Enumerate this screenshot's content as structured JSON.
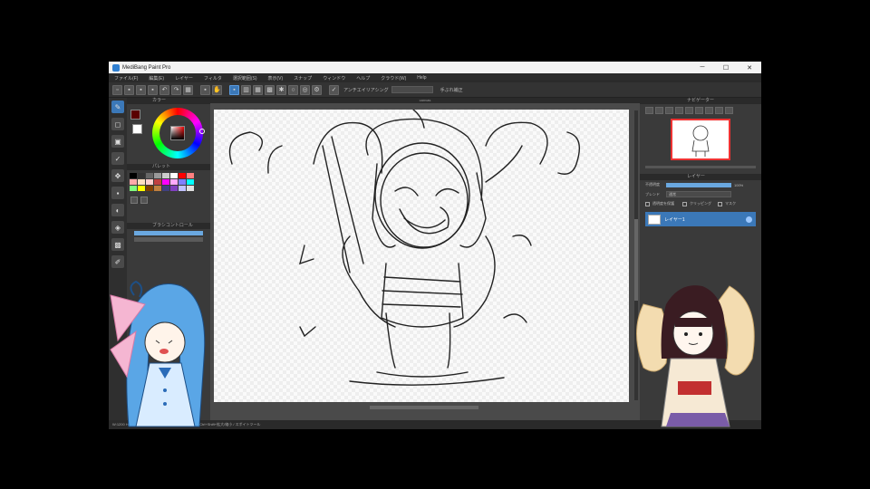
{
  "window": {
    "title": "MediBang Paint Pro",
    "minimize": "─",
    "maximize": "☐",
    "close": "✕"
  },
  "colors": {
    "accent": "#3b78b8",
    "panel": "#3a3a3a",
    "opacity_bar": "#6aa8e0",
    "navigator_border": "#ee3333"
  },
  "menu": {
    "items": [
      "ファイル(F)",
      "編集(E)",
      "レイヤー",
      "フィルタ",
      "選択範囲(S)",
      "表示(V)",
      "スナップ",
      "ウィンドウ",
      "ヘルプ",
      "クラウド(W)",
      "Help"
    ]
  },
  "toolbar": {
    "antialias_label": "アンチエイリアシング",
    "field_value": "",
    "right_label": "手ぶれ補正"
  },
  "canvas": {
    "tab_label": "canvas"
  },
  "left_panel": {
    "color_header": "カラー",
    "palette_header": "パレット",
    "brush_header": "ブラシコントロール",
    "palette_colors": [
      "#000000",
      "#333333",
      "#666666",
      "#999999",
      "#cccccc",
      "#ffffff",
      "#ff0000",
      "#ff8080",
      "#ffaaaa",
      "#ffe0c0",
      "#ffd0d0",
      "#c04040",
      "#ff00ff",
      "#ffaaff",
      "#8080ff",
      "#00ffff",
      "#80ff80",
      "#ffff00",
      "#804000",
      "#c08040",
      "#404080",
      "#8040c0",
      "#c0c0ff",
      "#e0e0e0"
    ]
  },
  "right_panel": {
    "navigator_header": "ナビゲーター",
    "layer_header": "レイヤー",
    "opacity_label": "不透明度",
    "opacity_value": "100%",
    "blend_label": "ブレンド",
    "blend_value": "通常",
    "protect_label": "透明度を保護",
    "clipping_label": "クリッピング",
    "mask_label": "マスク",
    "layer_name": "レイヤー1"
  },
  "status": {
    "text": "W:1200 H:800 | 250%  新規ブラシ | ブラシサイズ変更  Ctrl+Shift+拡大/縮小 / スポイトツール"
  }
}
